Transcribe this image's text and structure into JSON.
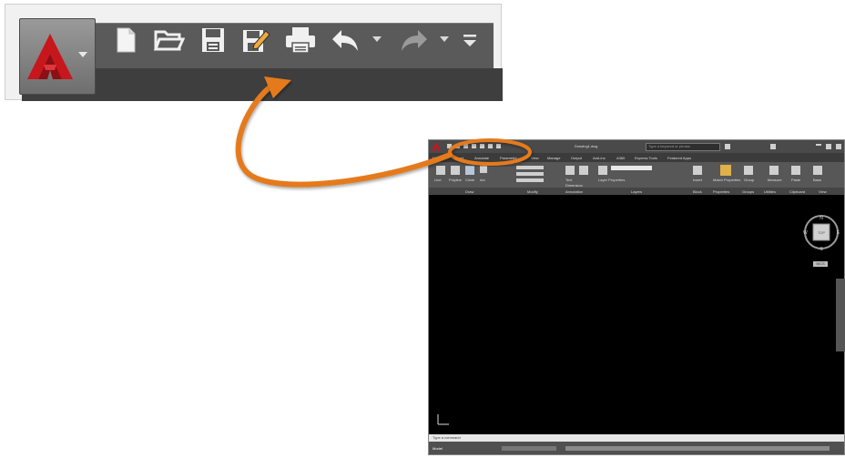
{
  "qat": {
    "buttons": [
      {
        "name": "new-icon",
        "label": "New"
      },
      {
        "name": "open-icon",
        "label": "Open"
      },
      {
        "name": "save-icon",
        "label": "Save"
      },
      {
        "name": "save-as-icon",
        "label": "Save As"
      },
      {
        "name": "plot-icon",
        "label": "Plot"
      },
      {
        "name": "undo-icon",
        "label": "Undo"
      },
      {
        "name": "redo-icon",
        "label": "Redo"
      },
      {
        "name": "customize-icon",
        "label": "Customize Quick Access Toolbar"
      }
    ]
  },
  "mini_app": {
    "title": "Drawing1.dwg",
    "search_placeholder": "Type a keyword or phrase",
    "tabs": [
      "Home",
      "Insert",
      "Annotate",
      "Parametric",
      "View",
      "Manage",
      "Output",
      "Add-ins",
      "A360",
      "Express Tools",
      "Featured Apps"
    ],
    "panels": [
      "Draw",
      "Modify",
      "Annotation",
      "Layers",
      "Block",
      "Properties",
      "Groups",
      "Utilities",
      "Clipboard",
      "View"
    ],
    "ribbon_buttons": [
      "Line",
      "Polyline",
      "Circle",
      "Arc",
      "Text",
      "Dimension",
      "Layer Properties",
      "Insert",
      "Match Properties",
      "Group",
      "Measure",
      "Paste",
      "Base"
    ],
    "viewcube": {
      "top": "TOP",
      "n": "N",
      "s": "S",
      "w": "W",
      "e": "E"
    },
    "wcs": "WCS",
    "command_line": "Type a command",
    "model_tab": "Model"
  },
  "colors": {
    "arrow": "#e57a1c",
    "highlight": "#e57a1c",
    "app_logo": "#c8161d"
  }
}
